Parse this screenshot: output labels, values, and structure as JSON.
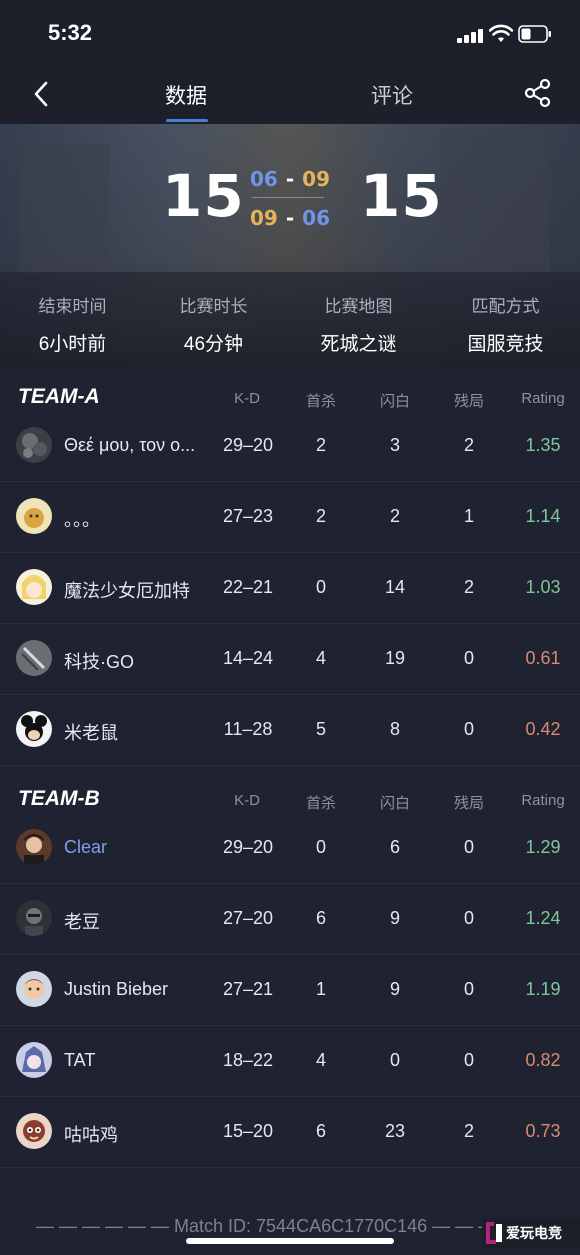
{
  "status_bar": {
    "time": "5:32"
  },
  "nav": {
    "tabs": [
      {
        "label": "数据"
      },
      {
        "label": "评论"
      }
    ]
  },
  "match": {
    "score_left": "15",
    "score_right": "15",
    "half_top": {
      "left": "06",
      "right": "09"
    },
    "half_bottom": {
      "left": "09",
      "right": "06"
    },
    "info": [
      {
        "label": "结束时间",
        "value": "6小时前"
      },
      {
        "label": "比赛时长",
        "value": "46分钟"
      },
      {
        "label": "比赛地图",
        "value": "死城之谜"
      },
      {
        "label": "匹配方式",
        "value": "国服竞技"
      }
    ]
  },
  "columns": [
    "K-D",
    "首杀",
    "闪白",
    "残局",
    "Rating"
  ],
  "teams": [
    {
      "name": "TEAM-A",
      "players": [
        {
          "name": "Θεέ μου, τον ο...",
          "kd": "29–20",
          "first_kills": "2",
          "flashes": "3",
          "clutches": "2",
          "rating": "1.35"
        },
        {
          "name": "。。。",
          "kd": "27–23",
          "first_kills": "2",
          "flashes": "2",
          "clutches": "1",
          "rating": "1.14"
        },
        {
          "name": "魔法少女厄加特",
          "kd": "22–21",
          "first_kills": "0",
          "flashes": "14",
          "clutches": "2",
          "rating": "1.03"
        },
        {
          "name": "科技·GO",
          "kd": "14–24",
          "first_kills": "4",
          "flashes": "19",
          "clutches": "0",
          "rating": "0.61"
        },
        {
          "name": "米老鼠",
          "kd": "11–28",
          "first_kills": "5",
          "flashes": "8",
          "clutches": "0",
          "rating": "0.42"
        }
      ]
    },
    {
      "name": "TEAM-B",
      "players": [
        {
          "name": "Clear",
          "kd": "29–20",
          "first_kills": "0",
          "flashes": "6",
          "clutches": "0",
          "rating": "1.29"
        },
        {
          "name": "老豆",
          "kd": "27–20",
          "first_kills": "6",
          "flashes": "9",
          "clutches": "0",
          "rating": "1.24"
        },
        {
          "name": "Justin Bieber",
          "kd": "27–21",
          "first_kills": "1",
          "flashes": "9",
          "clutches": "0",
          "rating": "1.19"
        },
        {
          "name": "TAT",
          "kd": "18–22",
          "first_kills": "4",
          "flashes": "0",
          "clutches": "0",
          "rating": "0.82"
        },
        {
          "name": "咕咕鸡",
          "kd": "15–20",
          "first_kills": "6",
          "flashes": "23",
          "clutches": "2",
          "rating": "0.73"
        }
      ]
    }
  ],
  "footer": {
    "match_id": "— — — — — — Match ID: 7544CA6C1770C146 — — —"
  },
  "watermark": {
    "text": "爱玩电竞"
  },
  "colors": {
    "accent": "#4a7fd6",
    "rating_good": "#7fc79a",
    "rating_bad": "#d98a72",
    "half_blue": "#6f95e6",
    "half_gold": "#e3b45c"
  }
}
